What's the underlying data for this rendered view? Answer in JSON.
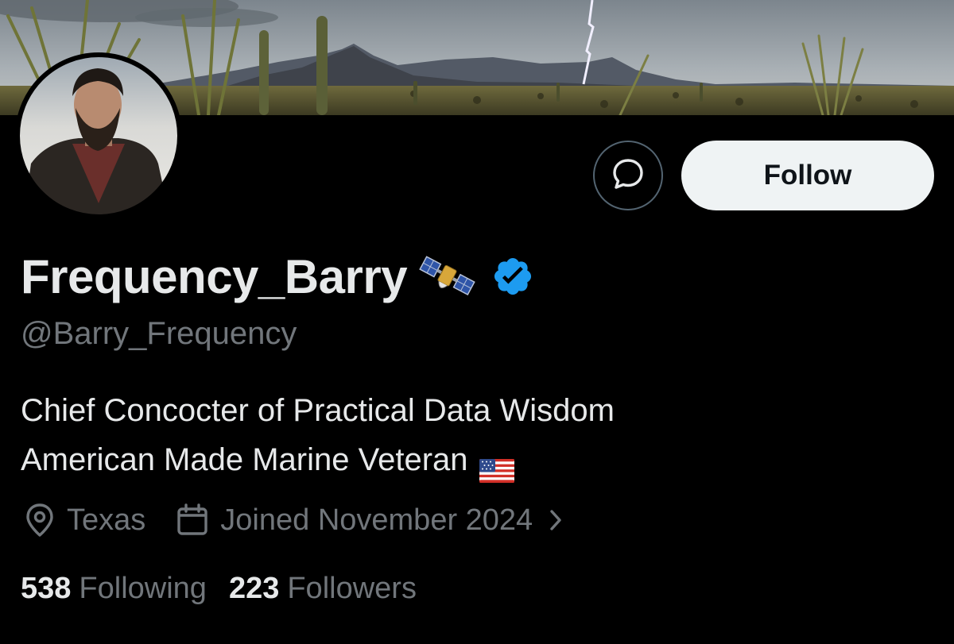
{
  "profile": {
    "display_name": "Frequency_Barry",
    "name_emoji": "satellite-icon",
    "verified": true,
    "handle": "@Barry_Frequency",
    "bio_lines": [
      "Chief Concocter of Practical Data Wisdom",
      "American Made Marine Veteran"
    ],
    "bio_emoji": "us-flag-icon",
    "location": "Texas",
    "joined": "Joined November 2024",
    "stats": {
      "following_count": "538",
      "following_label": "Following",
      "followers_count": "223",
      "followers_label": "Followers"
    }
  },
  "actions": {
    "message_icon": "message-bubble-icon",
    "follow_label": "Follow"
  },
  "colors": {
    "background": "#000000",
    "primary_text": "#e7e9ea",
    "secondary_text": "#71767b",
    "follow_button_bg": "#eff3f4",
    "verified_badge": "#1d9bf0"
  }
}
